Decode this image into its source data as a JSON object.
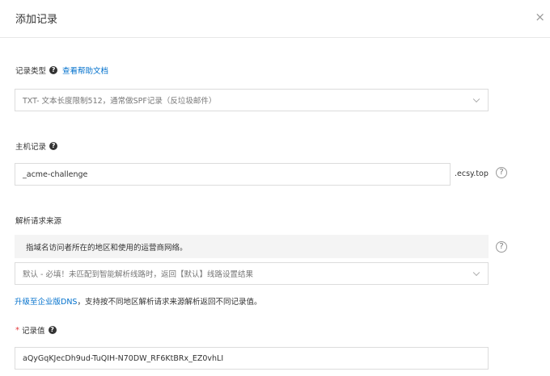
{
  "dialog": {
    "title": "添加记录",
    "close_glyph": "×"
  },
  "record_type": {
    "label": "记录类型",
    "help_link": "查看帮助文档",
    "selected": "TXT- 文本长度限制512，通常做SPF记录（反垃圾邮件）"
  },
  "host_record": {
    "label": "主机记录",
    "value": "_acme-challenge",
    "suffix": ".ecsy.top"
  },
  "resolve_source": {
    "label": "解析请求来源",
    "notice": "指域名访问者所在的地区和使用的运营商网络。",
    "selected": "默认 - 必填！未匹配到智能解析线路时，返回【默认】线路设置结果",
    "upgrade_link": "升级至企业版DNS",
    "upgrade_text": "，支持按不同地区解析请求来源解析返回不同记录值。"
  },
  "record_value": {
    "required_mark": "*",
    "label": "记录值",
    "value": "aQyGqKJecDh9ud-TuQIH-N70DW_RF6KtBRx_EZ0vhLI"
  },
  "icons": {
    "help_filled": "?",
    "help_outline": "?"
  }
}
